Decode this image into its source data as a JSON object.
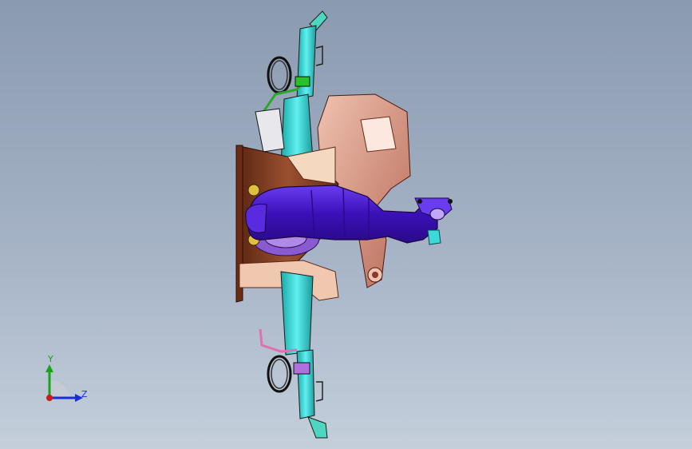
{
  "viewport": {
    "triad": {
      "y_label": "Y",
      "z_label": "Z"
    }
  },
  "colors": {
    "background_top": "#8a9ab0",
    "background_bottom": "#c4cfdb",
    "exhaust_pipe": "#4a12c8",
    "rail_cyan": "#3fd8d8",
    "heat_shield_salmon": "#d89a86",
    "bracket_brown": "#7a3a1c",
    "axis_y": "#1aa21a",
    "axis_z": "#1a2fd0",
    "axis_x": "#d01818"
  }
}
